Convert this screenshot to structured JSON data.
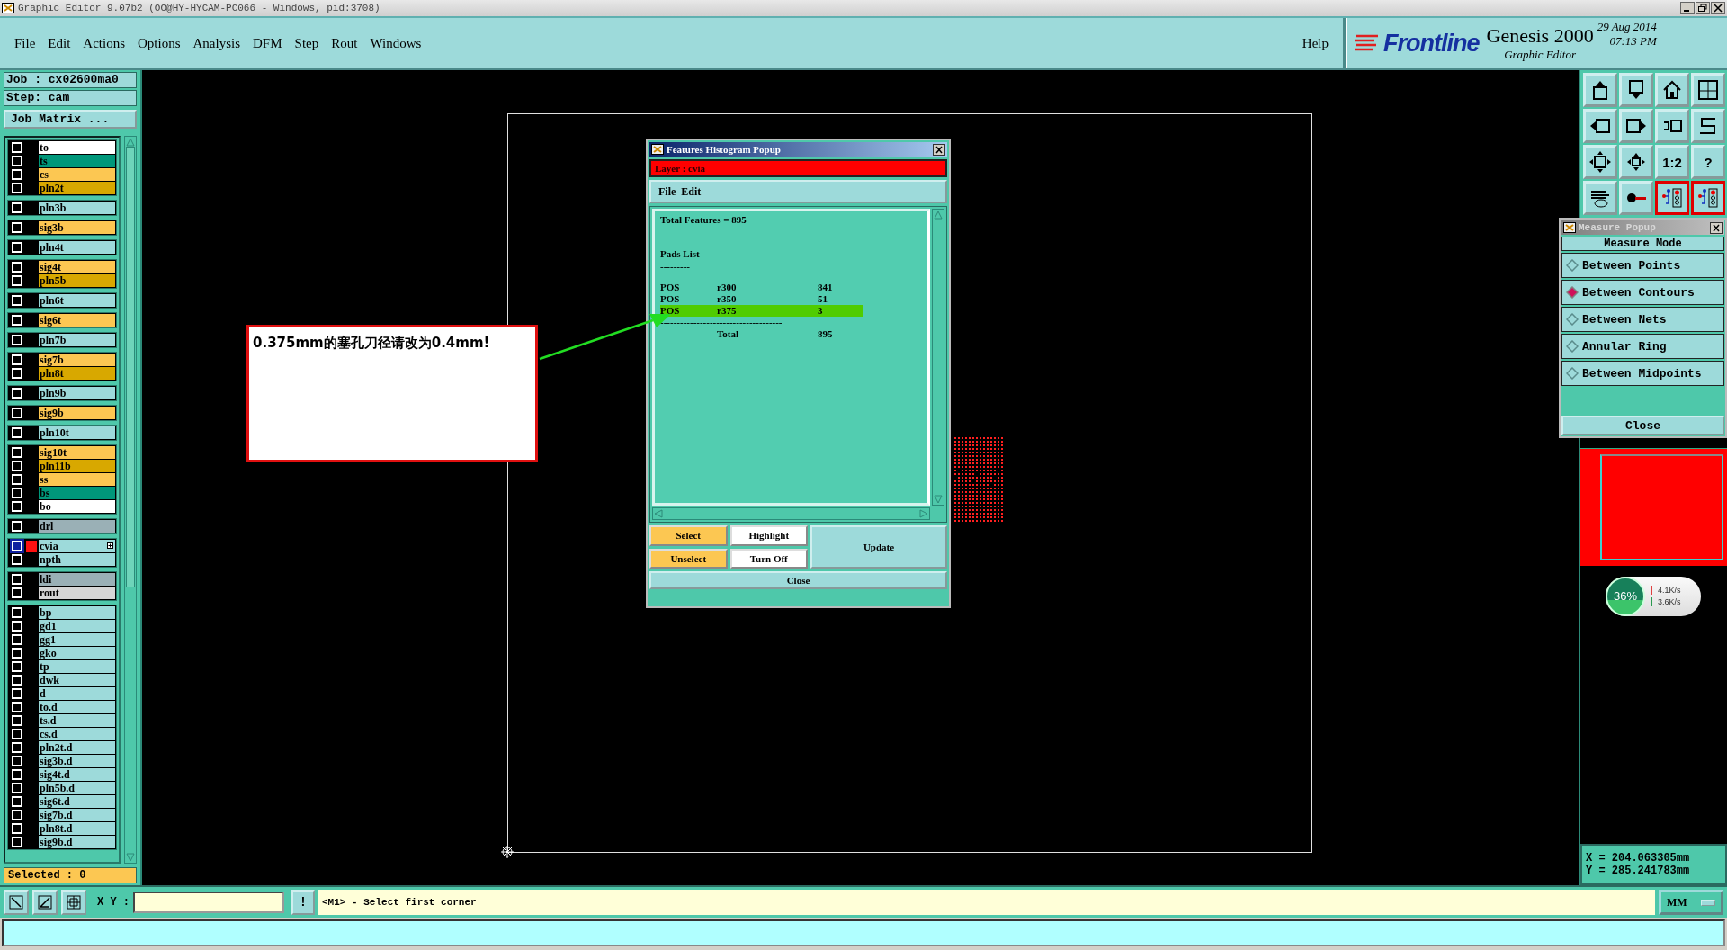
{
  "window": {
    "title": "Graphic Editor 9.07b2 (OO@HY-HYCAM-PC066 - Windows, pid:3708)"
  },
  "menu": [
    "File",
    "Edit",
    "Actions",
    "Options",
    "Analysis",
    "DFM",
    "Step",
    "Rout",
    "Windows"
  ],
  "help": "Help",
  "brand": {
    "logo": "Frontline",
    "product": "Genesis 2000",
    "subtitle": "Graphic Editor",
    "date": "29 Aug 2014",
    "time": "07:13 PM"
  },
  "job": {
    "job": "Job : cx02600ma0",
    "step": "Step: cam",
    "matrix_button": "Job Matrix ..."
  },
  "layer_groups": [
    {
      "layers": [
        {
          "name": "to",
          "color": "#ffffff",
          "selected": false
        },
        {
          "name": "ts",
          "color": "#00977a",
          "selected": false
        },
        {
          "name": "cs",
          "color": "#fcc752",
          "selected": false
        },
        {
          "name": "pln2t",
          "color": "#d8a800",
          "selected": false
        }
      ]
    },
    {
      "layers": [
        {
          "name": "pln3b",
          "color": "#9ddada",
          "selected": false
        }
      ]
    },
    {
      "layers": [
        {
          "name": "sig3b",
          "color": "#fcc752",
          "selected": false
        }
      ]
    },
    {
      "layers": [
        {
          "name": "pln4t",
          "color": "#9ddada",
          "selected": false
        }
      ]
    },
    {
      "layers": [
        {
          "name": "sig4t",
          "color": "#fcc752",
          "selected": false
        },
        {
          "name": "pln5b",
          "color": "#d8a800",
          "selected": false
        }
      ]
    },
    {
      "layers": [
        {
          "name": "pln6t",
          "color": "#9ddada",
          "selected": false
        }
      ]
    },
    {
      "layers": [
        {
          "name": "sig6t",
          "color": "#fcc752",
          "selected": false
        }
      ]
    },
    {
      "layers": [
        {
          "name": "pln7b",
          "color": "#9ddada",
          "selected": false
        }
      ]
    },
    {
      "layers": [
        {
          "name": "sig7b",
          "color": "#fcc752",
          "selected": false
        },
        {
          "name": "pln8t",
          "color": "#d8a800",
          "selected": false
        }
      ]
    },
    {
      "layers": [
        {
          "name": "pln9b",
          "color": "#9ddada",
          "selected": false
        }
      ]
    },
    {
      "layers": [
        {
          "name": "sig9b",
          "color": "#fcc752",
          "selected": false
        }
      ]
    },
    {
      "layers": [
        {
          "name": "pln10t",
          "color": "#9ddada",
          "selected": false
        }
      ]
    },
    {
      "layers": [
        {
          "name": "sig10t",
          "color": "#fcc752",
          "selected": false
        },
        {
          "name": "pln11b",
          "color": "#d8a800",
          "selected": false
        },
        {
          "name": "ss",
          "color": "#fcc752",
          "selected": false
        },
        {
          "name": "bs",
          "color": "#00977a",
          "selected": false
        },
        {
          "name": "bo",
          "color": "#ffffff",
          "selected": false
        }
      ]
    },
    {
      "layers": [
        {
          "name": "drl",
          "color": "#9ab0b6",
          "selected": false
        }
      ]
    },
    {
      "layers": [
        {
          "name": "cvia",
          "color": "#9ddada",
          "selected": true
        },
        {
          "name": "npth",
          "color": "#9ddada",
          "selected": false
        }
      ]
    },
    {
      "layers": [
        {
          "name": "ldi",
          "color": "#9ab0b6",
          "selected": false
        },
        {
          "name": "rout",
          "color": "#d6d6d6",
          "selected": false
        }
      ]
    },
    {
      "layers": [
        {
          "name": "bp",
          "color": "#9ddada",
          "selected": false
        },
        {
          "name": "gd1",
          "color": "#9ddada",
          "selected": false
        },
        {
          "name": "gg1",
          "color": "#9ddada",
          "selected": false
        },
        {
          "name": "gko",
          "color": "#9ddada",
          "selected": false
        },
        {
          "name": "tp",
          "color": "#9ddada",
          "selected": false
        },
        {
          "name": "dwk",
          "color": "#9ddada",
          "selected": false
        },
        {
          "name": "d",
          "color": "#9ddada",
          "selected": false
        },
        {
          "name": "to.d",
          "color": "#9ddada",
          "selected": false
        },
        {
          "name": "ts.d",
          "color": "#9ddada",
          "selected": false
        },
        {
          "name": "cs.d",
          "color": "#9ddada",
          "selected": false
        },
        {
          "name": "pln2t.d",
          "color": "#9ddada",
          "selected": false
        },
        {
          "name": "sig3b.d",
          "color": "#9ddada",
          "selected": false
        },
        {
          "name": "sig4t.d",
          "color": "#9ddada",
          "selected": false
        },
        {
          "name": "pln5b.d",
          "color": "#9ddada",
          "selected": false
        },
        {
          "name": "sig6t.d",
          "color": "#9ddada",
          "selected": false
        },
        {
          "name": "sig7b.d",
          "color": "#9ddada",
          "selected": false
        },
        {
          "name": "pln8t.d",
          "color": "#9ddada",
          "selected": false
        },
        {
          "name": "sig9b.d",
          "color": "#9ddada",
          "selected": false
        }
      ]
    }
  ],
  "selected_count": "Selected : 0",
  "annotation": {
    "text": "0.375mm的塞孔刀径请改为0.4mm!"
  },
  "histogram": {
    "title": "Features Histogram Popup",
    "layer": "Layer :  cvia",
    "menu": [
      "File",
      "Edit"
    ],
    "total_features": "Total Features = 895",
    "section": "Pads List",
    "underline": "---------",
    "rows": [
      {
        "type": "POS",
        "symbol": "r300",
        "count": "841",
        "selected": false
      },
      {
        "type": "POS",
        "symbol": "r350",
        "count": "51",
        "selected": false
      },
      {
        "type": "POS",
        "symbol": "r375",
        "count": "3",
        "selected": true
      }
    ],
    "separator": "-------------------------------------",
    "total_label": "Total",
    "total": "895",
    "buttons": [
      {
        "label": "Select",
        "kind": "select"
      },
      {
        "label": "Highlight",
        "kind": "display"
      },
      {
        "label": "Unselect",
        "kind": "select"
      },
      {
        "label": "Turn Off",
        "kind": "display"
      }
    ],
    "update": "Update",
    "close": "Close"
  },
  "toolbar": [
    {
      "kind": "up",
      "highlighted": false
    },
    {
      "kind": "down",
      "highlighted": false
    },
    {
      "kind": "home",
      "highlighted": false
    },
    {
      "kind": "grid",
      "highlighted": false
    },
    {
      "kind": "left",
      "highlighted": false
    },
    {
      "kind": "right",
      "highlighted": false
    },
    {
      "kind": "undo",
      "highlighted": false
    },
    {
      "kind": "snake",
      "highlighted": false
    },
    {
      "kind": "fit",
      "highlighted": false
    },
    {
      "kind": "center",
      "highlighted": false
    },
    {
      "kind": "text",
      "label": "1:2",
      "highlighted": false
    },
    {
      "kind": "text",
      "label": "?",
      "highlighted": false
    },
    {
      "kind": "tools",
      "highlighted": false
    },
    {
      "kind": "probe",
      "highlighted": false
    },
    {
      "kind": "netlist",
      "highlighted": true
    },
    {
      "kind": "netlist",
      "highlighted": true
    }
  ],
  "measure": {
    "title": "Measure Popup",
    "heading": "Measure Mode",
    "modes": [
      {
        "label": "Between Points",
        "selected": false
      },
      {
        "label": "Between Contours",
        "selected": true
      },
      {
        "label": "Between Nets",
        "selected": false
      },
      {
        "label": "Annular Ring",
        "selected": false
      },
      {
        "label": "Between Midpoints",
        "selected": false
      }
    ],
    "close": "Close"
  },
  "network": {
    "percent": "36%",
    "upload": "4.1K/s",
    "download": "3.6K/s"
  },
  "coords": {
    "x": "X = 204.063305mm",
    "y": "Y = 285.241783mm"
  },
  "bottom": {
    "xy_label": "X Y :",
    "alert": "!",
    "message": "<M1> - Select first corner",
    "units": "MM"
  }
}
